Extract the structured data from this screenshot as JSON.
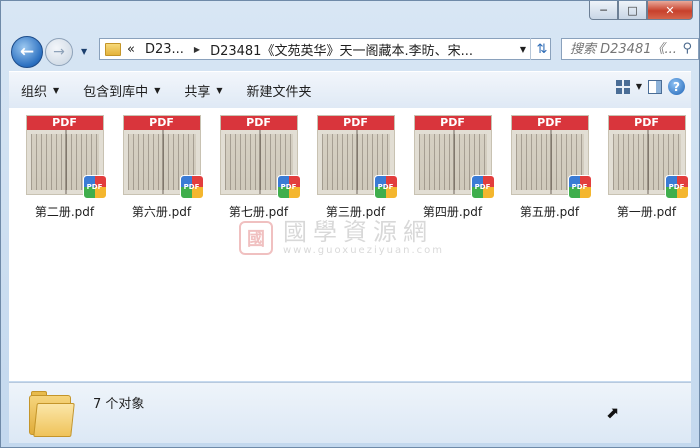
{
  "window": {
    "caption_buttons": [
      "minimize",
      "maximize",
      "close"
    ]
  },
  "nav": {
    "back_icon": "back-arrow-icon",
    "forward_icon": "forward-arrow-icon",
    "breadcrumb_prefix": "«",
    "breadcrumb": [
      "D23...",
      "D23481《文苑英华》天一阁藏本.李昉、宋..."
    ],
    "search_placeholder": "搜索 D23481《..."
  },
  "toolbar": {
    "organize": "组织",
    "include_in_library": "包含到库中",
    "share": "共享",
    "new_folder": "新建文件夹"
  },
  "files": [
    {
      "name": "第二册.pdf",
      "thumb_label": "PDF"
    },
    {
      "name": "第六册.pdf",
      "thumb_label": "PDF"
    },
    {
      "name": "第七册.pdf",
      "thumb_label": "PDF"
    },
    {
      "name": "第三册.pdf",
      "thumb_label": "PDF"
    },
    {
      "name": "第四册.pdf",
      "thumb_label": "PDF"
    },
    {
      "name": "第五册.pdf",
      "thumb_label": "PDF"
    },
    {
      "name": "第一册.pdf",
      "thumb_label": "PDF"
    }
  ],
  "badge_label": "PDF",
  "watermark": {
    "seal_char": "國",
    "title": "國學資源網",
    "url": "www.guoxueziyuan.com"
  },
  "status": {
    "count_text": "7 个对象"
  },
  "colors": {
    "pdf_band": "#d9353c",
    "window_frame": "#c9dcef"
  }
}
